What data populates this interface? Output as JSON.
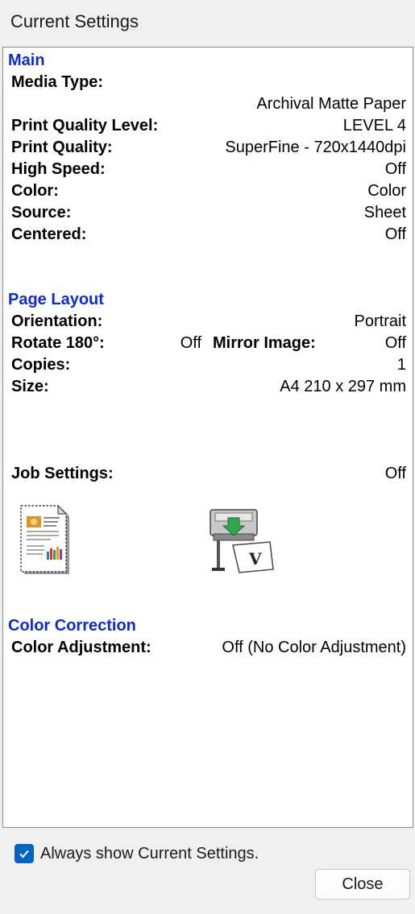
{
  "window": {
    "title": "Current Settings"
  },
  "main": {
    "title": "Main",
    "media_type_label": "Media Type:",
    "media_type_value": "Archival Matte Paper",
    "print_quality_level_label": "Print Quality Level:",
    "print_quality_level_value": "LEVEL 4",
    "print_quality_label": "Print Quality:",
    "print_quality_value": "SuperFine - 720x1440dpi",
    "high_speed_label": "High Speed:",
    "high_speed_value": "Off",
    "color_label": "Color:",
    "color_value": "Color",
    "source_label": "Source:",
    "source_value": "Sheet",
    "centered_label": "Centered:",
    "centered_value": "Off"
  },
  "page_layout": {
    "title": "Page Layout",
    "orientation_label": "Orientation:",
    "orientation_value": "Portrait",
    "rotate_label": "Rotate 180°:",
    "rotate_value": "Off",
    "mirror_label": "Mirror Image:",
    "mirror_value": "Off",
    "copies_label": "Copies:",
    "copies_value": "1",
    "size_label": "Size:",
    "size_value": "A4 210 x 297 mm"
  },
  "job_settings": {
    "label": "Job Settings:",
    "value": "Off",
    "icons": [
      "document-preview-icon",
      "printer-icon"
    ]
  },
  "color_correction": {
    "title": "Color Correction",
    "adjustment_label": "Color Adjustment:",
    "adjustment_value": "Off (No Color Adjustment)"
  },
  "footer": {
    "always_show_label": "Always show Current Settings.",
    "always_show_checked": true,
    "close_label": "Close"
  },
  "colors": {
    "section_title": "#0b2bd6",
    "checkbox": "#0067c0"
  }
}
